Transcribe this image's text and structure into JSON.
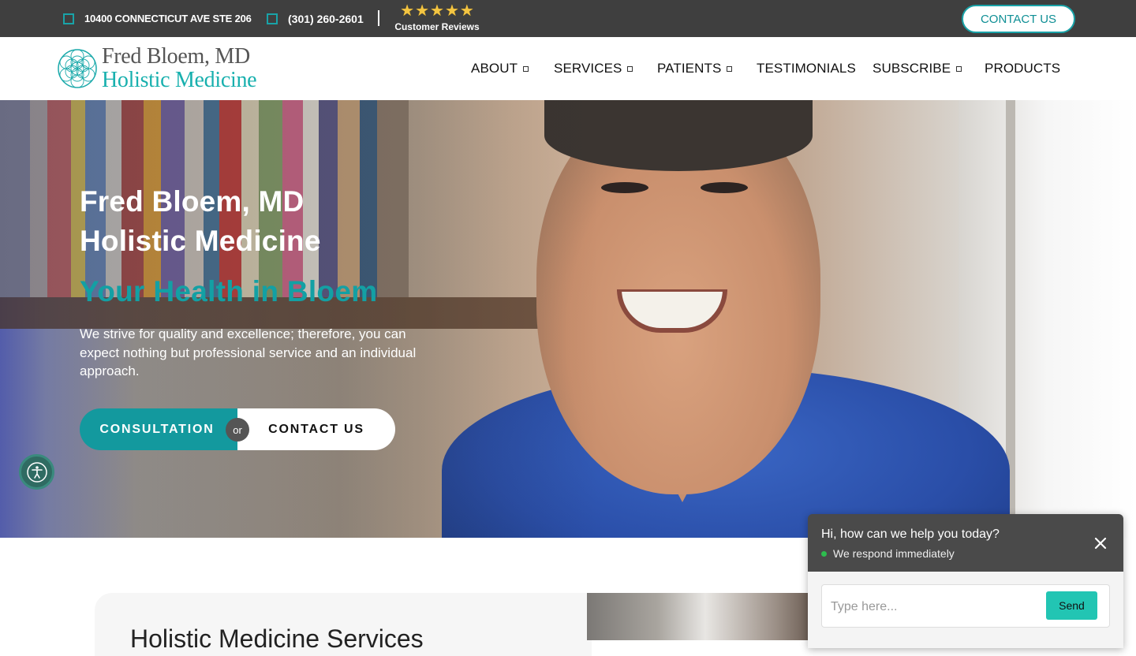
{
  "topbar": {
    "address": "10400 CONNECTICUT AVE STE 206",
    "phone": "(301) 260-2601",
    "reviews_label": "Customer Reviews",
    "stars": 5,
    "contact_label": "CONTACT US",
    "accent_color": "#19a3a8"
  },
  "nav": {
    "logo_line1": "Fred Bloem, MD",
    "logo_line2": "Holistic Medicine",
    "items": [
      {
        "label": "ABOUT",
        "dropdown": true
      },
      {
        "label": "SERVICES",
        "dropdown": true
      },
      {
        "label": "PATIENTS",
        "dropdown": true
      },
      {
        "label": "TESTIMONIALS",
        "dropdown": false
      },
      {
        "label": "SUBSCRIBE",
        "dropdown": true
      },
      {
        "label": "PRODUCTS",
        "dropdown": false
      }
    ]
  },
  "hero": {
    "title_line1": "Fred Bloem, MD",
    "title_line2": "Holistic Medicine",
    "tagline": "Your Health in Bloem",
    "description": "We strive for quality and excellence; therefore, you can expect nothing but professional service and an individual approach.",
    "consultation_label": "CONSULTATION",
    "or_label": "or",
    "contact_label": "CONTACT US",
    "tagline_color": "#13a0a4"
  },
  "services": {
    "title": "Holistic Medicine Services"
  },
  "chat": {
    "title": "Hi, how can we help you today?",
    "status": "We respond immediately",
    "placeholder": "Type here...",
    "send_label": "Send",
    "send_color": "#22c5b3"
  }
}
